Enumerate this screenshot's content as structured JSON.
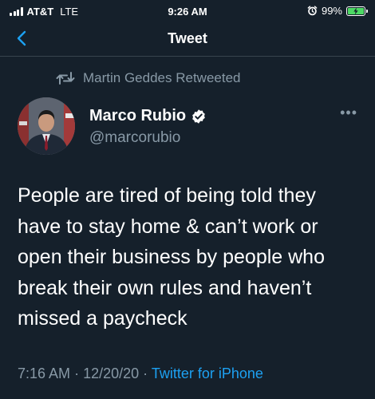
{
  "status_bar": {
    "carrier": "AT&T",
    "network": "LTE",
    "time": "9:26 AM",
    "battery": "99%",
    "battery_level": 0.99,
    "icons": [
      "signal-icon",
      "alarm-icon",
      "battery-charging-icon"
    ]
  },
  "nav": {
    "back_icon": "chevron-left-icon",
    "title": "Tweet"
  },
  "retweet": {
    "icon": "retweet-icon",
    "label": "Martin Geddes Retweeted"
  },
  "tweet": {
    "author_name": "Marco Rubio",
    "author_handle": "@marcorubio",
    "verified": true,
    "more_icon": "more-horizontal-icon",
    "text": "People are tired of being told they have to stay home & can’t work or open their business by people who break their own rules and haven’t missed a paycheck",
    "time": "7:16 AM",
    "separator": "·",
    "date": "12/20/20",
    "source": "Twitter for iPhone"
  },
  "colors": {
    "background": "#15202b",
    "accent": "#1da1f2",
    "muted": "#8899a6",
    "divider": "#38444d",
    "battery": "#4cd964"
  }
}
